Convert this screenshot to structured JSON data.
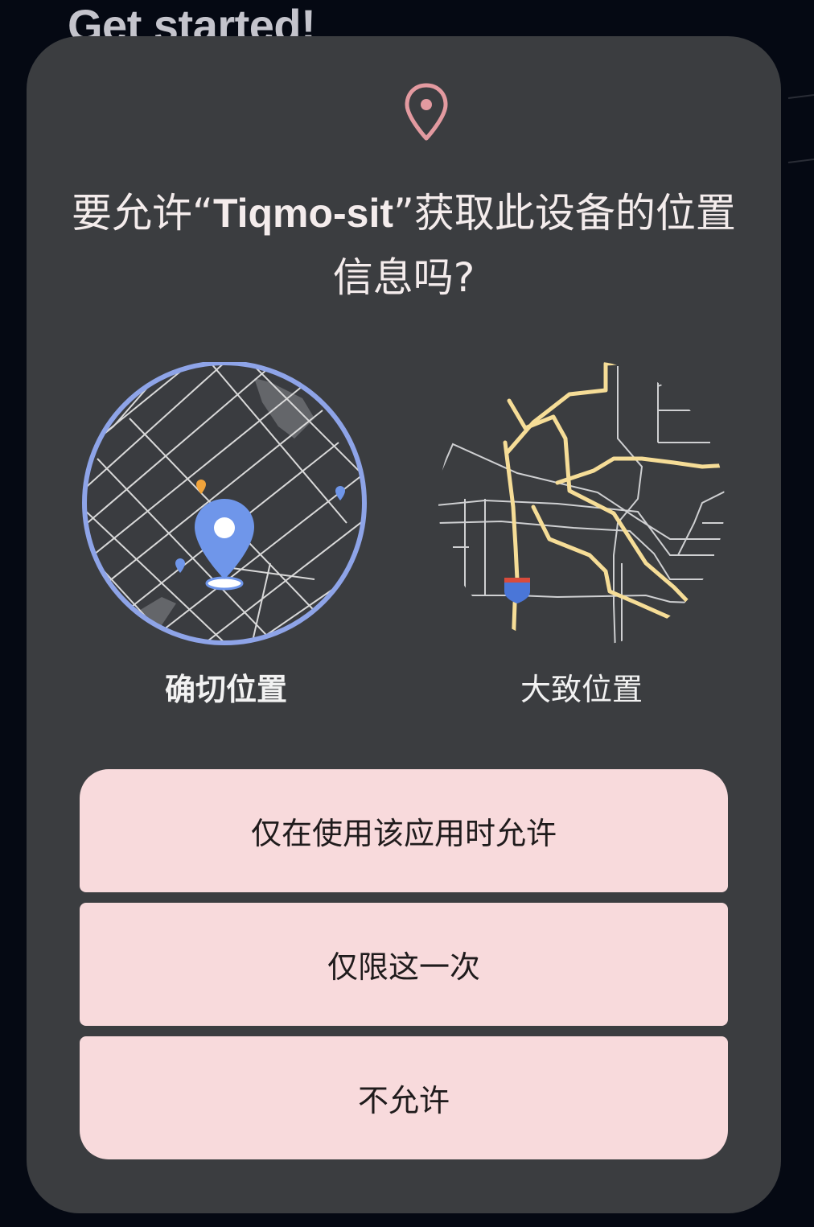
{
  "background": {
    "title": "Get started!"
  },
  "dialog": {
    "icon": "location-pin-icon",
    "title_prefix": "要允许“",
    "title_app": "Tiqmo-sit",
    "title_suffix": "”获取此设备的位置信息吗?",
    "options": {
      "precise": {
        "label": "确切位置",
        "selected": true,
        "icon": "precise-location-map-icon"
      },
      "approximate": {
        "label": "大致位置",
        "selected": false,
        "icon": "approximate-location-map-icon"
      }
    },
    "buttons": {
      "while_using": "仅在使用该应用时允许",
      "only_this_time": "仅限这一次",
      "deny": "不允许"
    }
  },
  "colors": {
    "dialog_bg": "#3b3d40",
    "button_bg": "#f8dadc",
    "accent_pin": "#e39aa0",
    "precise_ring": "#8ea4e8",
    "map_pin": "#6f96ea",
    "highway": "#f6dd97"
  }
}
